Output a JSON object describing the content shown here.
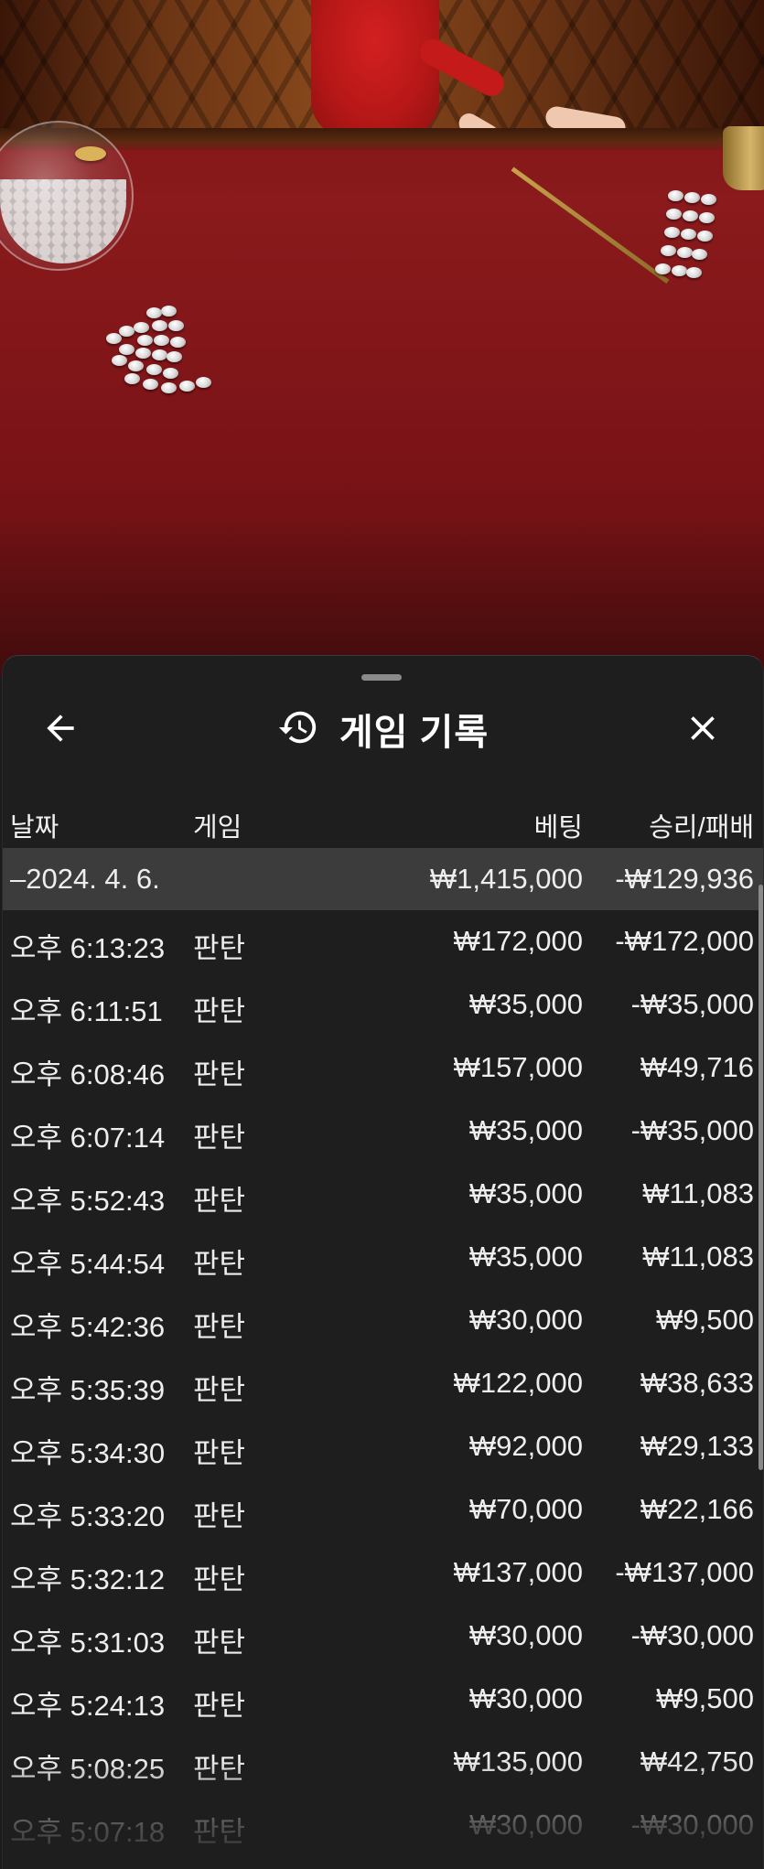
{
  "header": {
    "title": "게임 기록",
    "back_icon": "arrow-left-icon",
    "history_icon": "history-icon",
    "close_icon": "close-icon"
  },
  "columns": {
    "date": "날짜",
    "game": "게임",
    "bet": "베팅",
    "result": "승리/패배"
  },
  "date_group": {
    "date": "–2024. 4. 6.",
    "bet": "₩1,415,000",
    "result": "-₩129,936"
  },
  "rows": [
    {
      "time": "오후 6:13:23",
      "game": "판탄",
      "bet": "₩172,000",
      "result": "-₩172,000"
    },
    {
      "time": "오후 6:11:51",
      "game": "판탄",
      "bet": "₩35,000",
      "result": "-₩35,000"
    },
    {
      "time": "오후 6:08:46",
      "game": "판탄",
      "bet": "₩157,000",
      "result": "₩49,716"
    },
    {
      "time": "오후 6:07:14",
      "game": "판탄",
      "bet": "₩35,000",
      "result": "-₩35,000"
    },
    {
      "time": "오후 5:52:43",
      "game": "판탄",
      "bet": "₩35,000",
      "result": "₩11,083"
    },
    {
      "time": "오후 5:44:54",
      "game": "판탄",
      "bet": "₩35,000",
      "result": "₩11,083"
    },
    {
      "time": "오후 5:42:36",
      "game": "판탄",
      "bet": "₩30,000",
      "result": "₩9,500"
    },
    {
      "time": "오후 5:35:39",
      "game": "판탄",
      "bet": "₩122,000",
      "result": "₩38,633"
    },
    {
      "time": "오후 5:34:30",
      "game": "판탄",
      "bet": "₩92,000",
      "result": "₩29,133"
    },
    {
      "time": "오후 5:33:20",
      "game": "판탄",
      "bet": "₩70,000",
      "result": "₩22,166"
    },
    {
      "time": "오후 5:32:12",
      "game": "판탄",
      "bet": "₩137,000",
      "result": "-₩137,000"
    },
    {
      "time": "오후 5:31:03",
      "game": "판탄",
      "bet": "₩30,000",
      "result": "-₩30,000"
    },
    {
      "time": "오후 5:24:13",
      "game": "판탄",
      "bet": "₩30,000",
      "result": "₩9,500"
    },
    {
      "time": "오후 5:08:25",
      "game": "판탄",
      "bet": "₩135,000",
      "result": "₩42,750"
    },
    {
      "time": "오후 5:07:18",
      "game": "판탄",
      "bet": "₩30,000",
      "result": "-₩30,000"
    }
  ],
  "colors": {
    "sheet_bg": "#1e1e1e",
    "date_row_bg": "#3c3c3c",
    "text": "#eeeeee",
    "felt": "#8a1a1c"
  }
}
